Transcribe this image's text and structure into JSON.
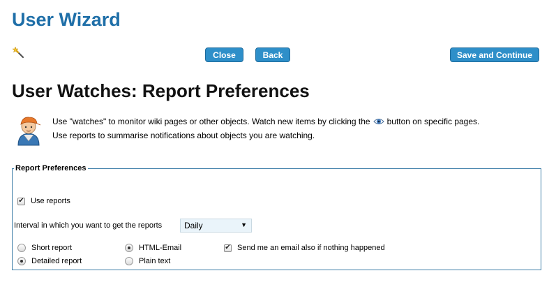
{
  "header": {
    "wizard_title": "User Wizard",
    "wand_icon": "magic-wand-icon"
  },
  "toolbar": {
    "close_label": "Close",
    "back_label": "Back",
    "save_label": "Save and Continue"
  },
  "page": {
    "title": "User Watches: Report Preferences",
    "avatar_icon": "user-avatar-icon",
    "intro_part1": "Use \"watches\" to monitor wiki pages or other objects. Watch new items by clicking the",
    "intro_part2": "button on specific pages.",
    "intro_line2": "Use reports to summarise notifications about objects you are watching.",
    "eye_icon": "eye-icon"
  },
  "preferences": {
    "legend": "Report Preferences",
    "use_reports_label": "Use reports",
    "use_reports_checked": true,
    "interval_label": "Interval in which you want to get the reports",
    "interval_value": "Daily",
    "report_length": {
      "short_label": "Short report",
      "detailed_label": "Detailed report",
      "selected": "detailed"
    },
    "format": {
      "html_label": "HTML-Email",
      "plain_label": "Plain text",
      "selected": "html"
    },
    "empty_email_label": "Send me an email also if nothing happened",
    "empty_email_checked": true
  },
  "colors": {
    "title_blue": "#1f6fa8",
    "button_blue": "#2e8fc9",
    "fieldset_border": "#3d7ea8"
  }
}
